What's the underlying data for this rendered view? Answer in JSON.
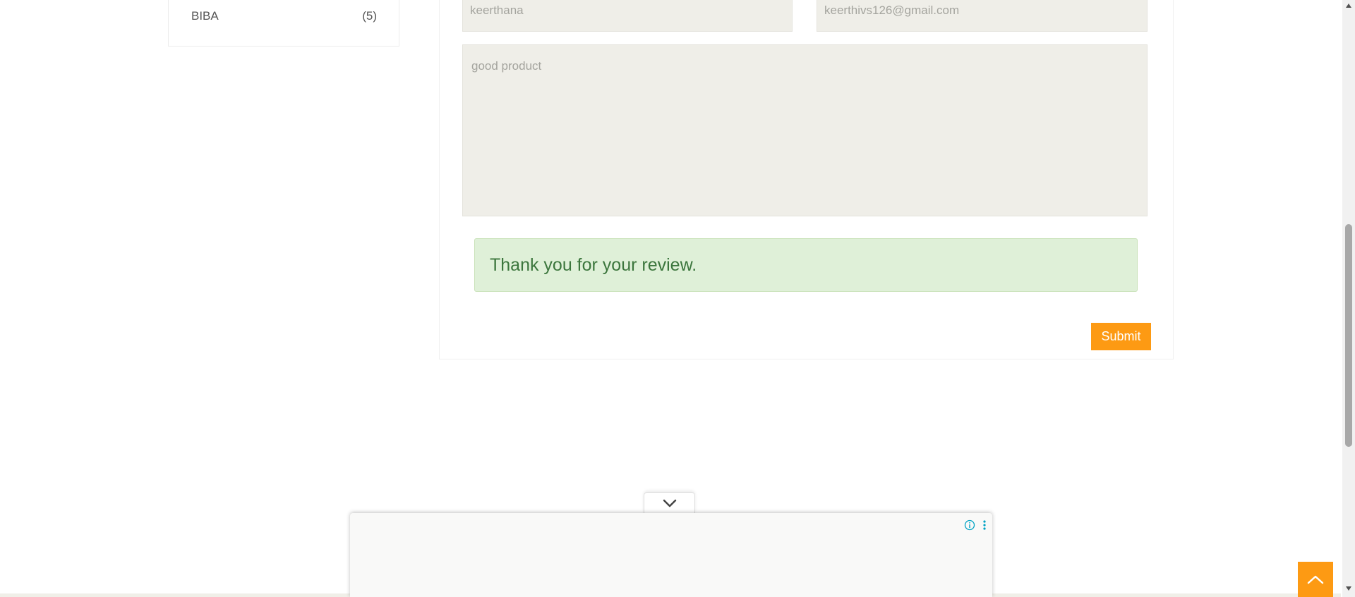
{
  "sidebar": {
    "brand": {
      "name": "BIBA",
      "count": "(5)"
    }
  },
  "review_form": {
    "name_value": "keerthana",
    "email_value": "keerthivs126@gmail.com",
    "comment_value": "good product",
    "success_message": "Thank you for your review.",
    "submit_label": "Submit"
  },
  "ad": {
    "collapse_icon": "chevron-down-icon",
    "info_icon": "info-icon",
    "menu_icon": "kebab-menu-icon"
  },
  "colors": {
    "accent": "#fd9a13",
    "success_bg": "#dff0d8",
    "success_text": "#3c763d",
    "field_bg": "#efeee8"
  }
}
